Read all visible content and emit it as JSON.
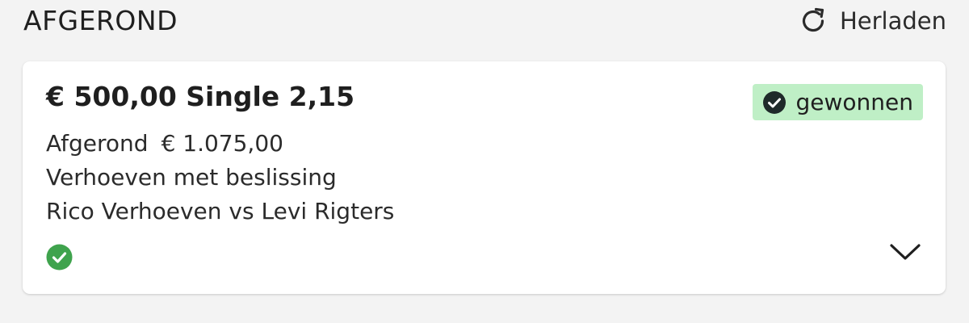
{
  "header": {
    "title": "AFGEROND",
    "reload_label": "Herladen",
    "reload_icon": "refresh-icon"
  },
  "bet": {
    "title": "€ 500,00 Single 2,15",
    "status": {
      "label": "gewonnen",
      "icon": "check-circle-icon",
      "background": "#bfefc6",
      "icon_color": "#1f2a2a"
    },
    "settled_label": "Afgerond",
    "payout": "€ 1.075,00",
    "selection": "Verhoeven met beslissing",
    "event": "Rico Verhoeven vs Levi Rigters",
    "leg_status_icon": "green-check-circle-icon",
    "leg_status_color": "#3fa34d",
    "expand_icon": "chevron-down-icon"
  }
}
